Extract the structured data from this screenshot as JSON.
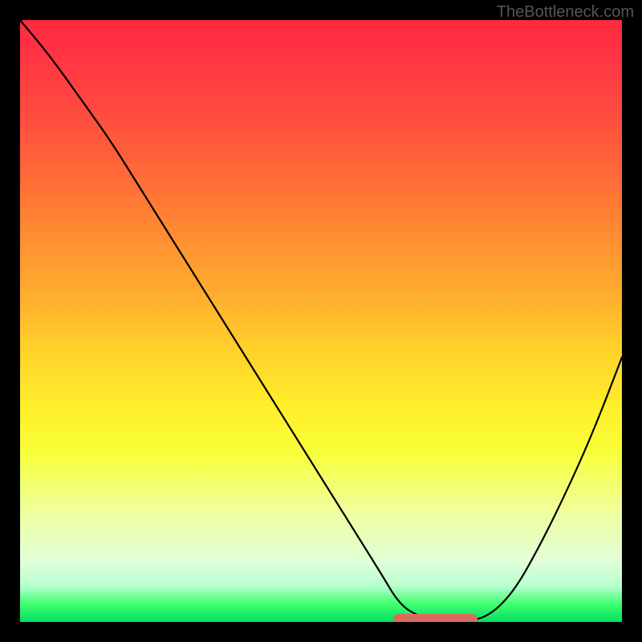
{
  "watermark": "TheBottleneck.com",
  "chart_data": {
    "type": "line",
    "title": "",
    "xlabel": "",
    "ylabel": "",
    "xlim": [
      0,
      100
    ],
    "ylim": [
      0,
      100
    ],
    "series": [
      {
        "name": "curve",
        "x": [
          0,
          5,
          10,
          15,
          20,
          25,
          30,
          35,
          40,
          45,
          50,
          55,
          60,
          63,
          66,
          70,
          74,
          78,
          82,
          86,
          90,
          95,
          100
        ],
        "values": [
          100,
          94,
          87,
          80,
          72,
          64,
          56,
          48,
          40,
          32,
          24,
          16,
          8,
          3,
          1,
          0,
          0,
          1,
          5,
          12,
          20,
          31,
          44
        ]
      }
    ],
    "highlight_range": {
      "x_start": 62,
      "x_end": 76,
      "y": 0
    },
    "annotations": []
  }
}
